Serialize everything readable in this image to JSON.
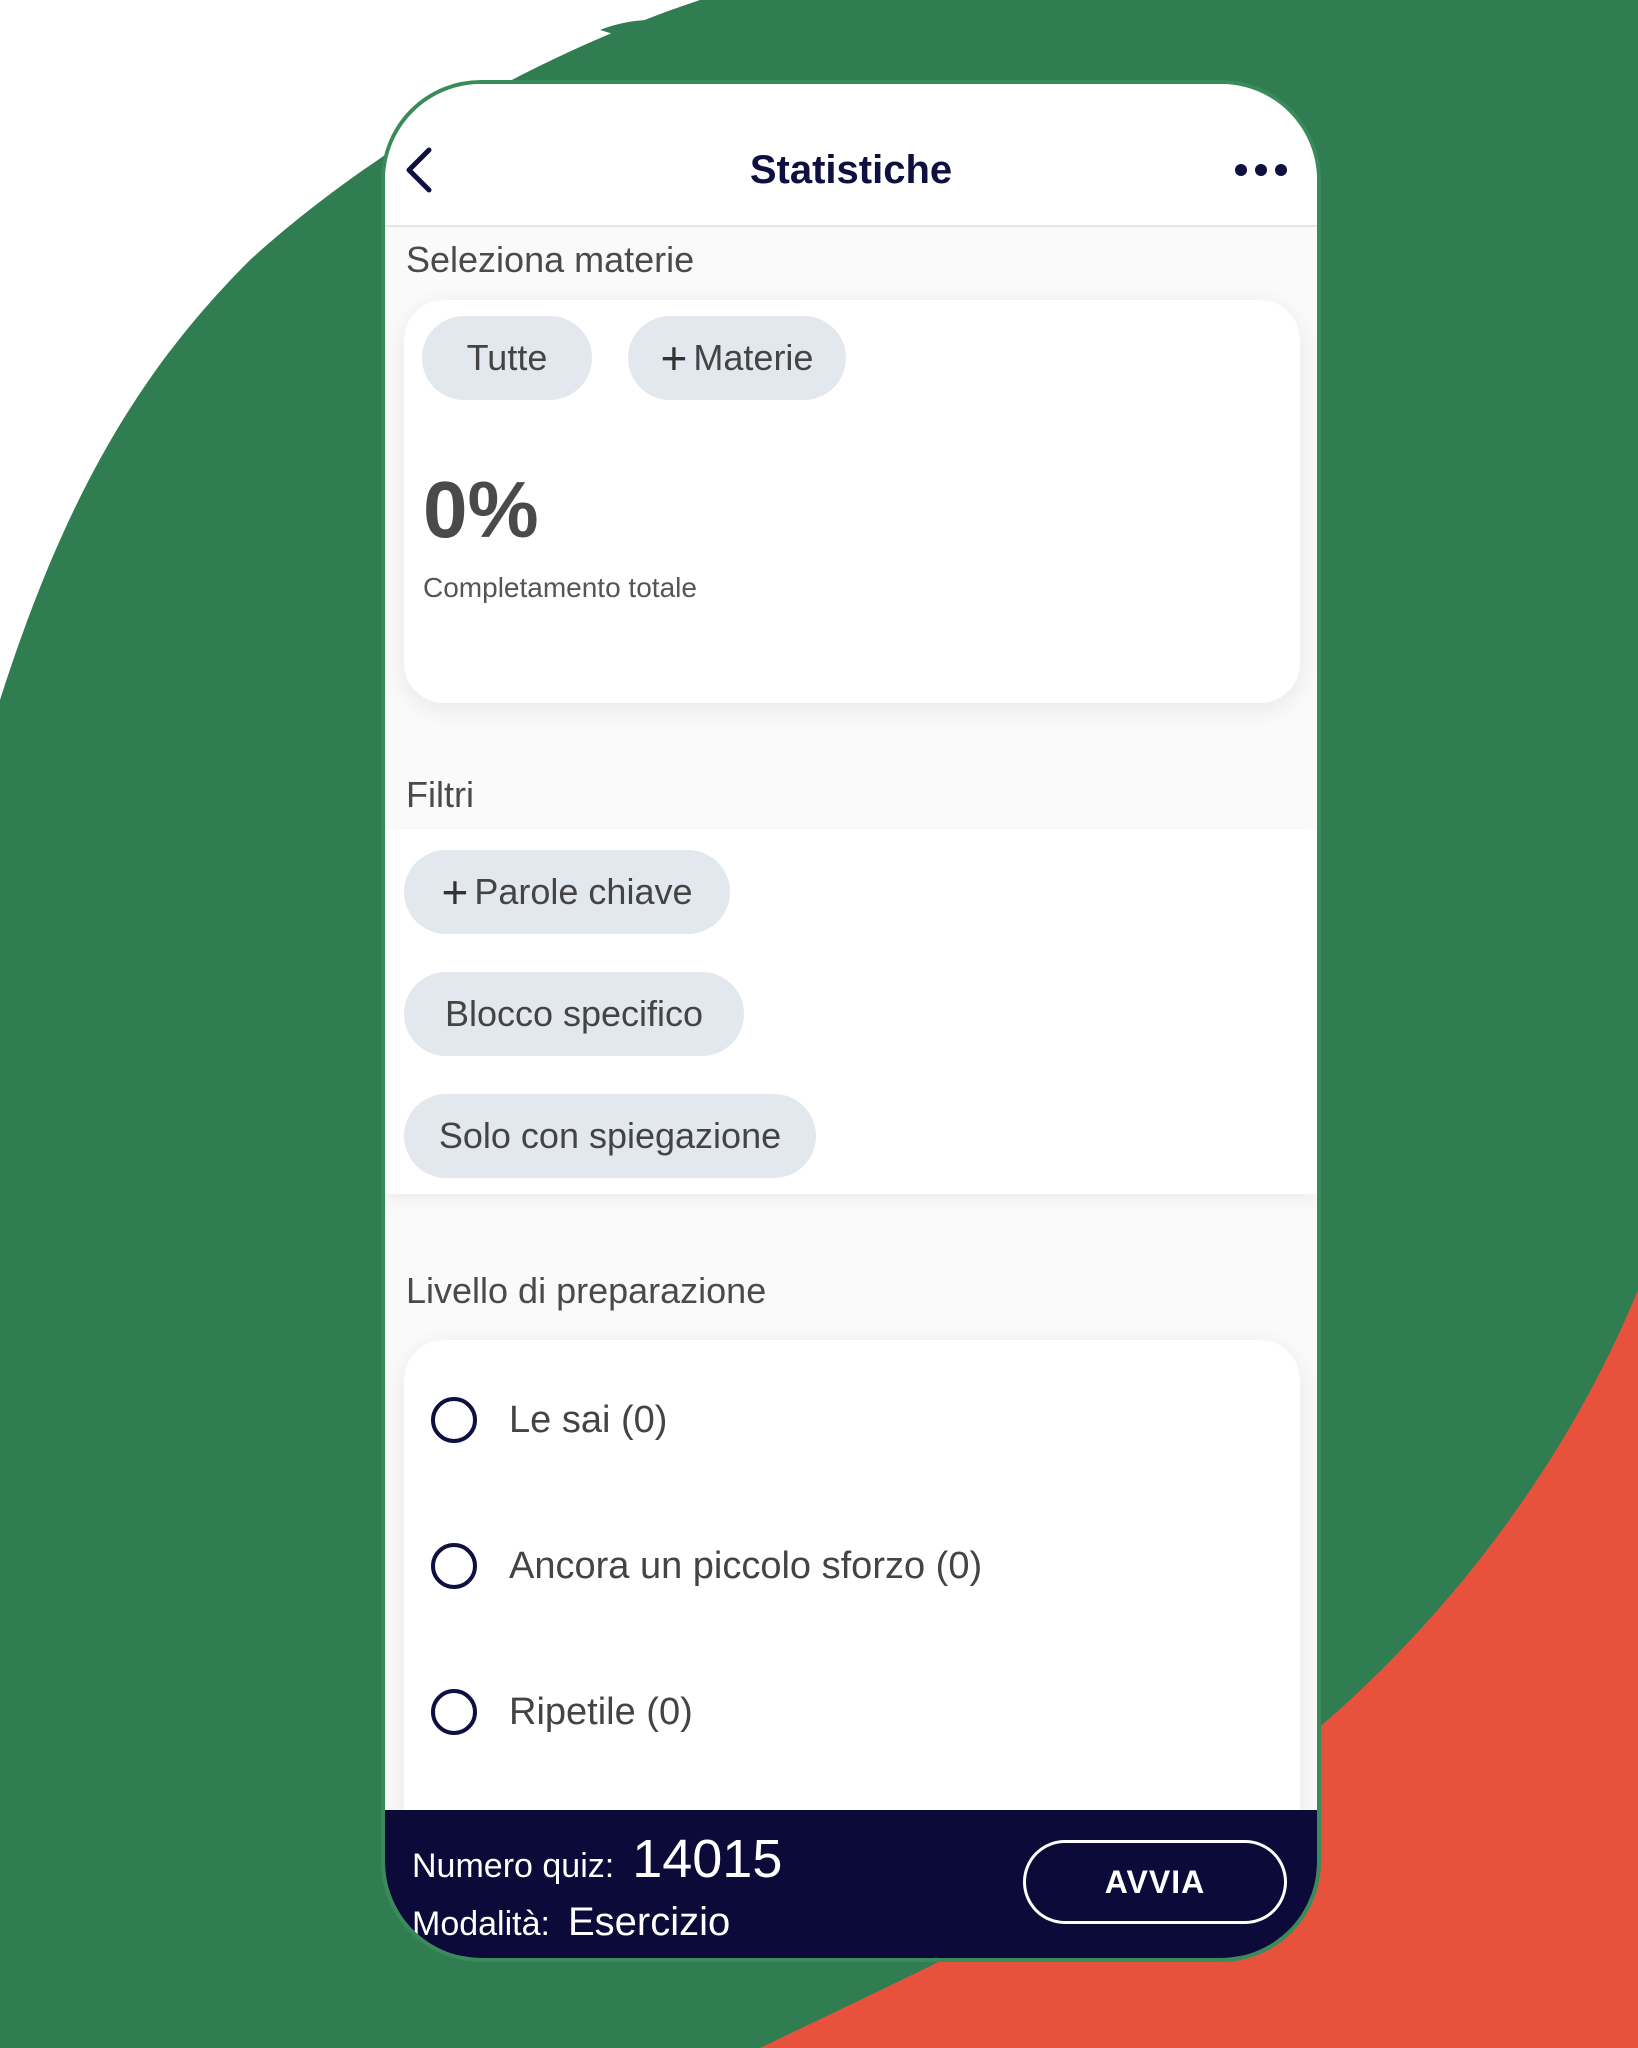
{
  "header": {
    "title": "Statistiche"
  },
  "subjects": {
    "section_label": "Seleziona materie",
    "chips": [
      "Tutte",
      "Materie"
    ],
    "completion_value": "0%",
    "completion_label": "Completamento totale"
  },
  "filters": {
    "section_label": "Filtri",
    "chips": [
      "Parole chiave",
      "Blocco specifico",
      "Solo con spiegazione"
    ]
  },
  "preparation": {
    "section_label": "Livello di preparazione",
    "options": [
      "Le sai (0)",
      "Ancora un piccolo sforzo (0)",
      "Ripetile (0)"
    ]
  },
  "footer": {
    "quiz_count_label": "Numero quiz:",
    "quiz_count_value": "14015",
    "mode_label": "Modalità:",
    "mode_value": "Esercizio",
    "start_label": "AVVIA"
  },
  "colors": {
    "background_green": "#2f7d51",
    "accent_orange": "#e8523d",
    "navy": "#0b0a38",
    "chip_bg": "#e3e8ef"
  }
}
